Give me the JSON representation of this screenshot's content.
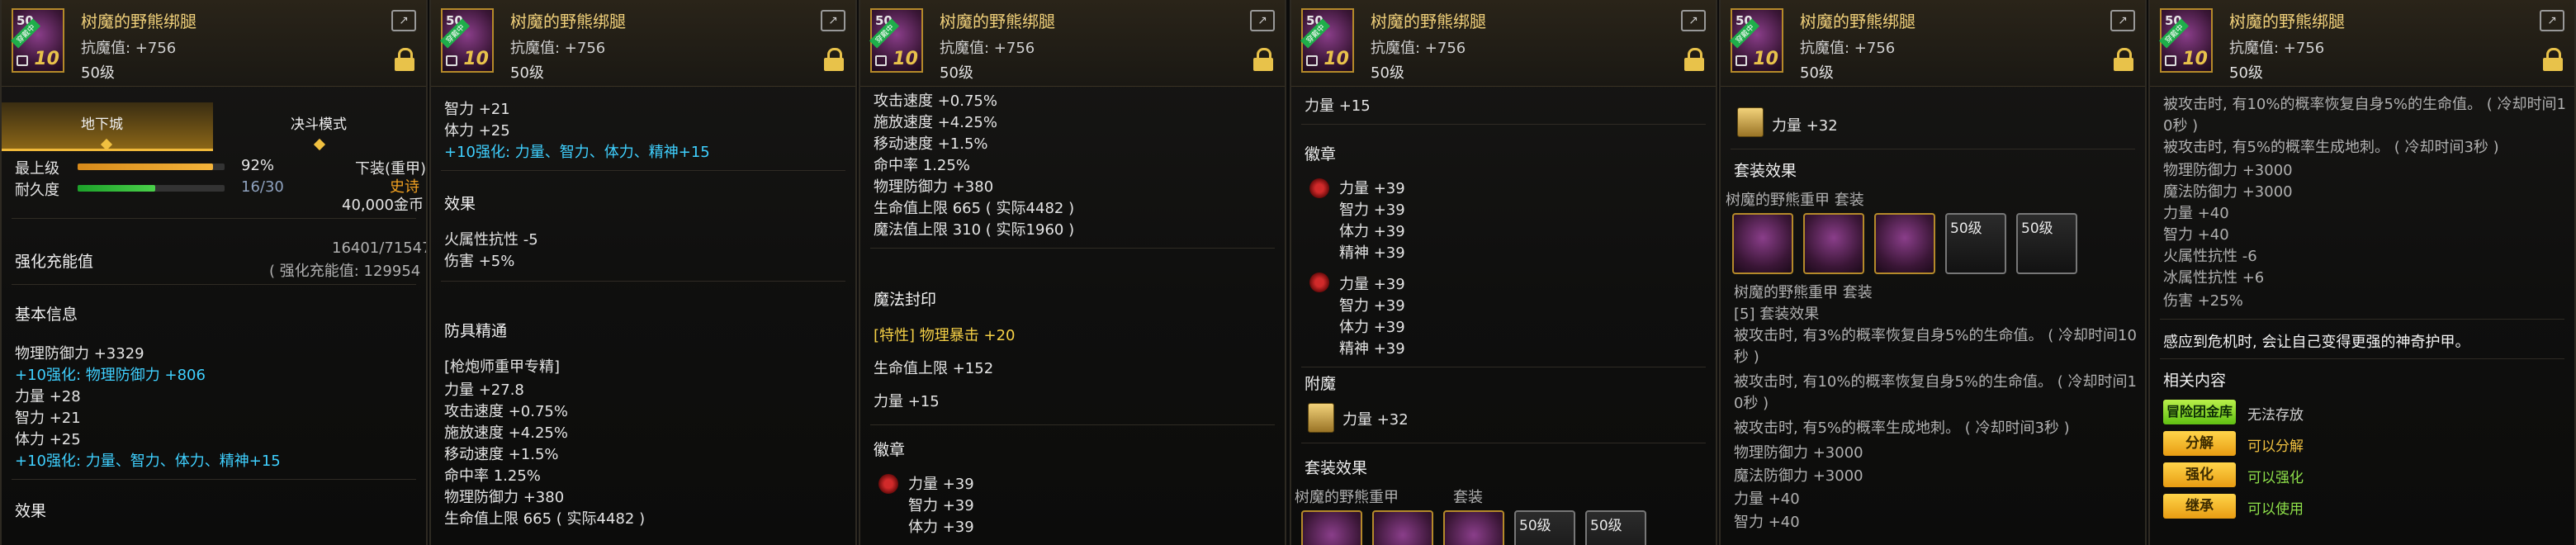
{
  "item": {
    "name": "树魔的野熊绑腿",
    "resist": "抗魔值: +756",
    "level": "50级",
    "icon_level": "50",
    "icon_plus": "10",
    "icon_tag": "穿戴中"
  },
  "panel1": {
    "tab_dungeon": "地下城",
    "tab_duel": "决斗模式",
    "best_label": "最上级",
    "best_pct": "92%",
    "best_value": 0.92,
    "durability_label": "耐久度",
    "durability": "16/30",
    "durability_value": 0.53,
    "type_label": "下装(重甲)",
    "rarity": "史诗",
    "price": "40,000金币",
    "enhance_label": "强化充能值",
    "enhance_value": "16401/71547",
    "enhance_sub": "( 强化充能值: 129954 )",
    "basic_header": "基本信息",
    "phys_def": "物理防御力 +3329",
    "plus10_def": "+10强化: 物理防御力 +806",
    "str": "力量 +28",
    "int": "智力 +21",
    "vit": "体力 +25",
    "plus10_stats": "+10强化: 力量、智力、体力、精神+15",
    "effect_header": "效果"
  },
  "panel2": {
    "int": "智力 +21",
    "vit": "体力 +25",
    "plus10_stats": "+10强化: 力量、智力、体力、精神+15",
    "effect_header": "效果",
    "fire_res": "火属性抗性 -5",
    "damage": "伤害 +5%",
    "mastery_header": "防具精通",
    "mastery_sub": "[枪炮师重甲专精]",
    "str": "力量 +27.8",
    "atk_speed": "攻击速度 +0.75%",
    "cast_speed": "施放速度 +4.25%",
    "move_speed": "移动速度 +1.5%",
    "hit": "命中率 1.25%",
    "phys_def": "物理防御力 +380",
    "hp": "生命值上限 665 ( 实际4482 )"
  },
  "panel3": {
    "atk_speed": "攻击速度 +0.75%",
    "cast_speed": "施放速度 +4.25%",
    "move_speed": "移动速度 +1.5%",
    "hit": "命中率 1.25%",
    "phys_def": "物理防御力 +380",
    "hp": "生命值上限 665 ( 实际4482 )",
    "mp": "魔法值上限 310 ( 实际1960 )",
    "seal_header": "魔法封印",
    "seal_trait": "[特性] 物理暴击 +20",
    "seal_hp": "生命值上限 +152",
    "seal_str": "力量 +15",
    "emblem_header": "徽章",
    "em_str": "力量 +39",
    "em_int": "智力 +39",
    "em_vit": "体力 +39"
  },
  "panel4": {
    "str": "力量 +15",
    "emblem_header": "徽章",
    "e1": [
      "力量 +39",
      "智力 +39",
      "体力 +39",
      "精神 +39"
    ],
    "e2": [
      "力量 +39",
      "智力 +39",
      "体力 +39",
      "精神 +39"
    ],
    "enchant_header": "附魔",
    "enchant": "力量 +32",
    "set_header": "套装效果",
    "set_name": "树魔的野熊重甲",
    "set_word": "套装",
    "set_lv1": "50级",
    "set_lv2": "50级"
  },
  "panel5": {
    "enchant": "力量 +32",
    "set_header": "套装效果",
    "set_name": "树魔的野熊重甲  套装",
    "set_lv1": "50级",
    "set_lv2": "50级",
    "set_name2": "树魔的野熊重甲  套装",
    "set_count": "[5] 套装效果",
    "eff1": "被攻击时, 有3%的概率恢复自身5%的生命值。 ( 冷却时间10",
    "eff1b": "秒 )",
    "eff2": "被攻击时, 有10%的概率恢复自身5%的生命值。 ( 冷却时间1",
    "eff2b": "0秒 )",
    "eff3": "被攻击时, 有5%的概率生成地刺。 ( 冷却时间3秒 )",
    "phys_def": "物理防御力 +3000",
    "magic_def": "魔法防御力 +3000",
    "str": "力量 +40",
    "int": "智力 +40"
  },
  "panel6": {
    "top1": "被攻击时, 有10%的概率恢复自身5%的生命值。 ( 冷却时间1",
    "top1b": "0秒 )",
    "top2": "被攻击时, 有5%的概率生成地刺。 ( 冷却时间3秒 )",
    "phys_def": "物理防御力 +3000",
    "magic_def": "魔法防御力 +3000",
    "str": "力量 +40",
    "int": "智力 +40",
    "fire_res": "火属性抗性 -6",
    "ice_res": "冰属性抗性 +6",
    "damage": "伤害 +25%",
    "flavor": "感应到危机时, 会让自己变得更强的神奇护甲。",
    "related_header": "相关内容",
    "btn_storage": "冒险团金库",
    "storage_note": "无法存放",
    "btn_decompose": "分解",
    "decompose_note": "可以分解",
    "btn_enhance": "强化",
    "enhance_note": "可以强化",
    "btn_inherit": "继承",
    "inherit_note": "可以使用"
  }
}
